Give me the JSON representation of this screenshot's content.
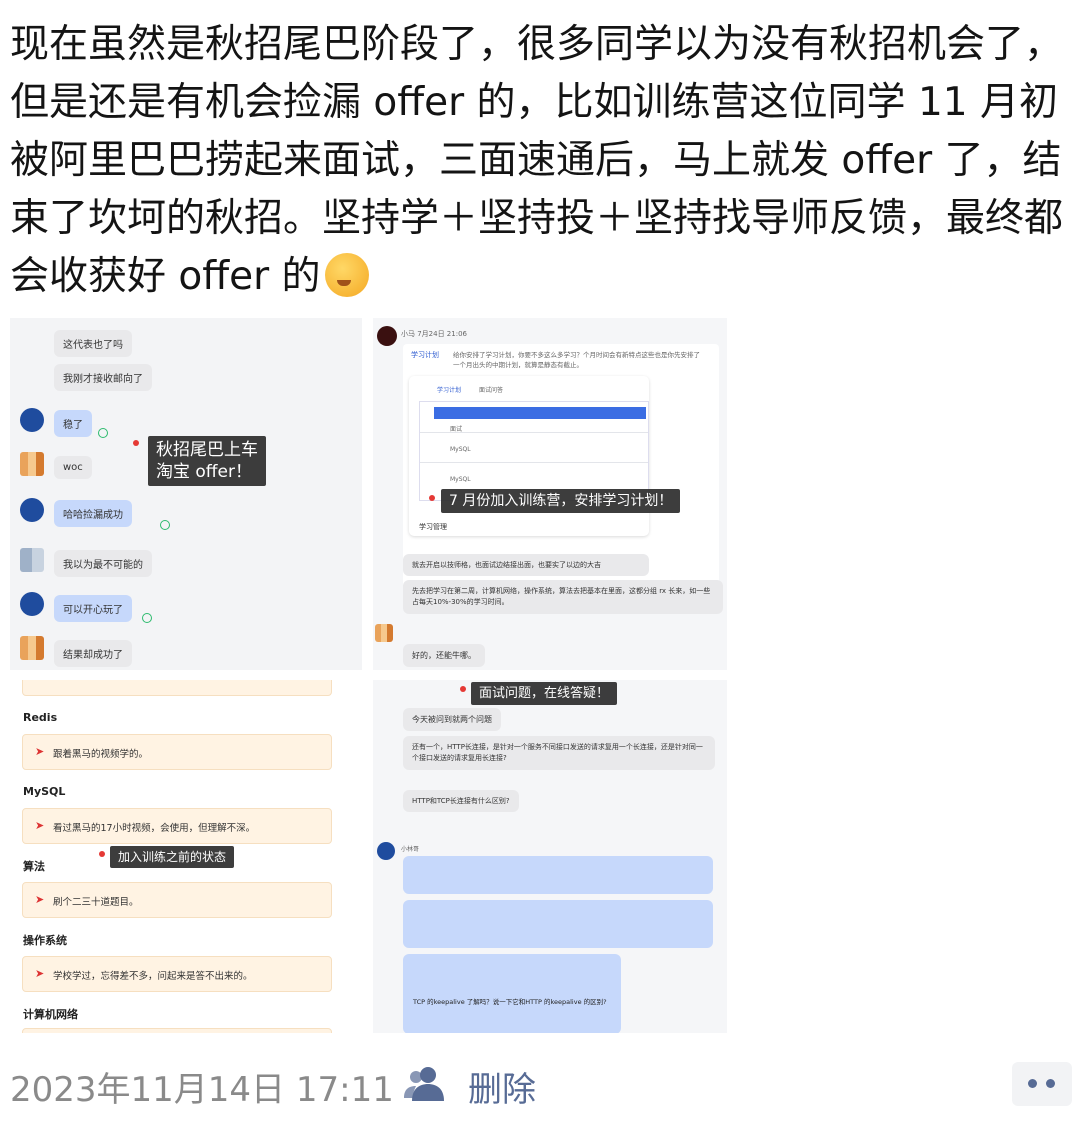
{
  "post": {
    "text": "现在虽然是秋招尾巴阶段了，很多同学以为没有秋招机会了，但是还是有机会捡漏 offer 的，比如训练营这位同学 11 月初被阿里巴巴捞起来面试，三面速通后，马上就发 offer 了，结束了坎坷的秋招。坚持学＋坚持投＋坚持找导师反馈，最终都会收获好 offer 的"
  },
  "images": {
    "top_left": {
      "messages": [
        "这代表也了吗",
        "我刚才接收邮向了",
        "稳了",
        "woc",
        "哈哈捡漏成功",
        "我以为最不可能的",
        "可以开心玩了",
        "结果却成功了"
      ],
      "label": "秋招尾巴上车\n淘宝 offer！"
    },
    "top_right": {
      "sender": "小马  7月24日 21:06",
      "intro_title": "学习计划",
      "intro": "给你安排了学习计划，你要不多这么多学习？个月时间会有新特点这些也是你先安排了一个月出头的中期计划，就算是静态有截止。",
      "doc_tabs": [
        "学习计划",
        "面试问答"
      ],
      "doc_rows": [
        "面试",
        "MySQL",
        "MySQL"
      ],
      "doc_footer": "学习管理",
      "messages": [
        "就去开启以技师格，也面试边结接出面，也要实了以边的大吉",
        "先去把学习在第二周，计算机网络，操作系统，算法去把基本在里面，这都分组 rx 长来，如一些占每天10%-30%的学习时间。",
        "好的，还能牛哪。"
      ],
      "label": "7 月份加入训练营，安排学习计划！"
    },
    "bottom_left": {
      "sections": [
        {
          "title": "Redis",
          "note": "跟着黑马的视频学的。"
        },
        {
          "title": "MySQL",
          "note": "看过黑马的17小时视频，会使用，但理解不深。"
        },
        {
          "title": "算法",
          "note": "刷个二三十道题目。"
        },
        {
          "title": "操作系统",
          "note": "学校学过，忘得差不多，问起来是答不出来的。"
        },
        {
          "title": "计算机网络",
          "note": ""
        }
      ],
      "label": "加入训练之前的状态"
    },
    "bottom_right": {
      "messages": [
        "今天被问到就两个问题",
        "还有一个，HTTP长连接，是针对一个服务不同接口发送的请求复用一个长连接，还是针对同一个接口发送的请求复用长连接?",
        "HTTP和TCP长连接有什么区别?",
        "TCP 的keepalive 了解吗？说一下它和HTTP 的keepalive 的区别?"
      ],
      "sender": "小林哥",
      "label": "面试问题，在线答疑！"
    }
  },
  "footer": {
    "timestamp": "2023年11月14日 17:11",
    "delete_label": "删除"
  },
  "colors": {
    "link": "#576b95",
    "timestamp": "#8a8a8a",
    "bubble_blue": "#c6d8fb",
    "note_bg": "#fff3e3"
  }
}
